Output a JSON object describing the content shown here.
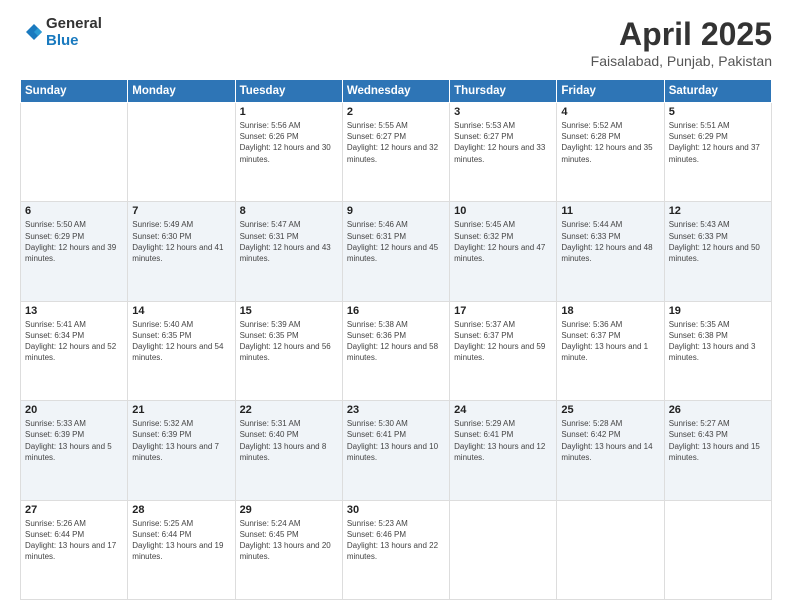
{
  "logo": {
    "general": "General",
    "blue": "Blue"
  },
  "title": "April 2025",
  "location": "Faisalabad, Punjab, Pakistan",
  "weekdays": [
    "Sunday",
    "Monday",
    "Tuesday",
    "Wednesday",
    "Thursday",
    "Friday",
    "Saturday"
  ],
  "weeks": [
    [
      {
        "day": "",
        "sunrise": "",
        "sunset": "",
        "daylight": ""
      },
      {
        "day": "",
        "sunrise": "",
        "sunset": "",
        "daylight": ""
      },
      {
        "day": "1",
        "sunrise": "Sunrise: 5:56 AM",
        "sunset": "Sunset: 6:26 PM",
        "daylight": "Daylight: 12 hours and 30 minutes."
      },
      {
        "day": "2",
        "sunrise": "Sunrise: 5:55 AM",
        "sunset": "Sunset: 6:27 PM",
        "daylight": "Daylight: 12 hours and 32 minutes."
      },
      {
        "day": "3",
        "sunrise": "Sunrise: 5:53 AM",
        "sunset": "Sunset: 6:27 PM",
        "daylight": "Daylight: 12 hours and 33 minutes."
      },
      {
        "day": "4",
        "sunrise": "Sunrise: 5:52 AM",
        "sunset": "Sunset: 6:28 PM",
        "daylight": "Daylight: 12 hours and 35 minutes."
      },
      {
        "day": "5",
        "sunrise": "Sunrise: 5:51 AM",
        "sunset": "Sunset: 6:29 PM",
        "daylight": "Daylight: 12 hours and 37 minutes."
      }
    ],
    [
      {
        "day": "6",
        "sunrise": "Sunrise: 5:50 AM",
        "sunset": "Sunset: 6:29 PM",
        "daylight": "Daylight: 12 hours and 39 minutes."
      },
      {
        "day": "7",
        "sunrise": "Sunrise: 5:49 AM",
        "sunset": "Sunset: 6:30 PM",
        "daylight": "Daylight: 12 hours and 41 minutes."
      },
      {
        "day": "8",
        "sunrise": "Sunrise: 5:47 AM",
        "sunset": "Sunset: 6:31 PM",
        "daylight": "Daylight: 12 hours and 43 minutes."
      },
      {
        "day": "9",
        "sunrise": "Sunrise: 5:46 AM",
        "sunset": "Sunset: 6:31 PM",
        "daylight": "Daylight: 12 hours and 45 minutes."
      },
      {
        "day": "10",
        "sunrise": "Sunrise: 5:45 AM",
        "sunset": "Sunset: 6:32 PM",
        "daylight": "Daylight: 12 hours and 47 minutes."
      },
      {
        "day": "11",
        "sunrise": "Sunrise: 5:44 AM",
        "sunset": "Sunset: 6:33 PM",
        "daylight": "Daylight: 12 hours and 48 minutes."
      },
      {
        "day": "12",
        "sunrise": "Sunrise: 5:43 AM",
        "sunset": "Sunset: 6:33 PM",
        "daylight": "Daylight: 12 hours and 50 minutes."
      }
    ],
    [
      {
        "day": "13",
        "sunrise": "Sunrise: 5:41 AM",
        "sunset": "Sunset: 6:34 PM",
        "daylight": "Daylight: 12 hours and 52 minutes."
      },
      {
        "day": "14",
        "sunrise": "Sunrise: 5:40 AM",
        "sunset": "Sunset: 6:35 PM",
        "daylight": "Daylight: 12 hours and 54 minutes."
      },
      {
        "day": "15",
        "sunrise": "Sunrise: 5:39 AM",
        "sunset": "Sunset: 6:35 PM",
        "daylight": "Daylight: 12 hours and 56 minutes."
      },
      {
        "day": "16",
        "sunrise": "Sunrise: 5:38 AM",
        "sunset": "Sunset: 6:36 PM",
        "daylight": "Daylight: 12 hours and 58 minutes."
      },
      {
        "day": "17",
        "sunrise": "Sunrise: 5:37 AM",
        "sunset": "Sunset: 6:37 PM",
        "daylight": "Daylight: 12 hours and 59 minutes."
      },
      {
        "day": "18",
        "sunrise": "Sunrise: 5:36 AM",
        "sunset": "Sunset: 6:37 PM",
        "daylight": "Daylight: 13 hours and 1 minute."
      },
      {
        "day": "19",
        "sunrise": "Sunrise: 5:35 AM",
        "sunset": "Sunset: 6:38 PM",
        "daylight": "Daylight: 13 hours and 3 minutes."
      }
    ],
    [
      {
        "day": "20",
        "sunrise": "Sunrise: 5:33 AM",
        "sunset": "Sunset: 6:39 PM",
        "daylight": "Daylight: 13 hours and 5 minutes."
      },
      {
        "day": "21",
        "sunrise": "Sunrise: 5:32 AM",
        "sunset": "Sunset: 6:39 PM",
        "daylight": "Daylight: 13 hours and 7 minutes."
      },
      {
        "day": "22",
        "sunrise": "Sunrise: 5:31 AM",
        "sunset": "Sunset: 6:40 PM",
        "daylight": "Daylight: 13 hours and 8 minutes."
      },
      {
        "day": "23",
        "sunrise": "Sunrise: 5:30 AM",
        "sunset": "Sunset: 6:41 PM",
        "daylight": "Daylight: 13 hours and 10 minutes."
      },
      {
        "day": "24",
        "sunrise": "Sunrise: 5:29 AM",
        "sunset": "Sunset: 6:41 PM",
        "daylight": "Daylight: 13 hours and 12 minutes."
      },
      {
        "day": "25",
        "sunrise": "Sunrise: 5:28 AM",
        "sunset": "Sunset: 6:42 PM",
        "daylight": "Daylight: 13 hours and 14 minutes."
      },
      {
        "day": "26",
        "sunrise": "Sunrise: 5:27 AM",
        "sunset": "Sunset: 6:43 PM",
        "daylight": "Daylight: 13 hours and 15 minutes."
      }
    ],
    [
      {
        "day": "27",
        "sunrise": "Sunrise: 5:26 AM",
        "sunset": "Sunset: 6:44 PM",
        "daylight": "Daylight: 13 hours and 17 minutes."
      },
      {
        "day": "28",
        "sunrise": "Sunrise: 5:25 AM",
        "sunset": "Sunset: 6:44 PM",
        "daylight": "Daylight: 13 hours and 19 minutes."
      },
      {
        "day": "29",
        "sunrise": "Sunrise: 5:24 AM",
        "sunset": "Sunset: 6:45 PM",
        "daylight": "Daylight: 13 hours and 20 minutes."
      },
      {
        "day": "30",
        "sunrise": "Sunrise: 5:23 AM",
        "sunset": "Sunset: 6:46 PM",
        "daylight": "Daylight: 13 hours and 22 minutes."
      },
      {
        "day": "",
        "sunrise": "",
        "sunset": "",
        "daylight": ""
      },
      {
        "day": "",
        "sunrise": "",
        "sunset": "",
        "daylight": ""
      },
      {
        "day": "",
        "sunrise": "",
        "sunset": "",
        "daylight": ""
      }
    ]
  ]
}
